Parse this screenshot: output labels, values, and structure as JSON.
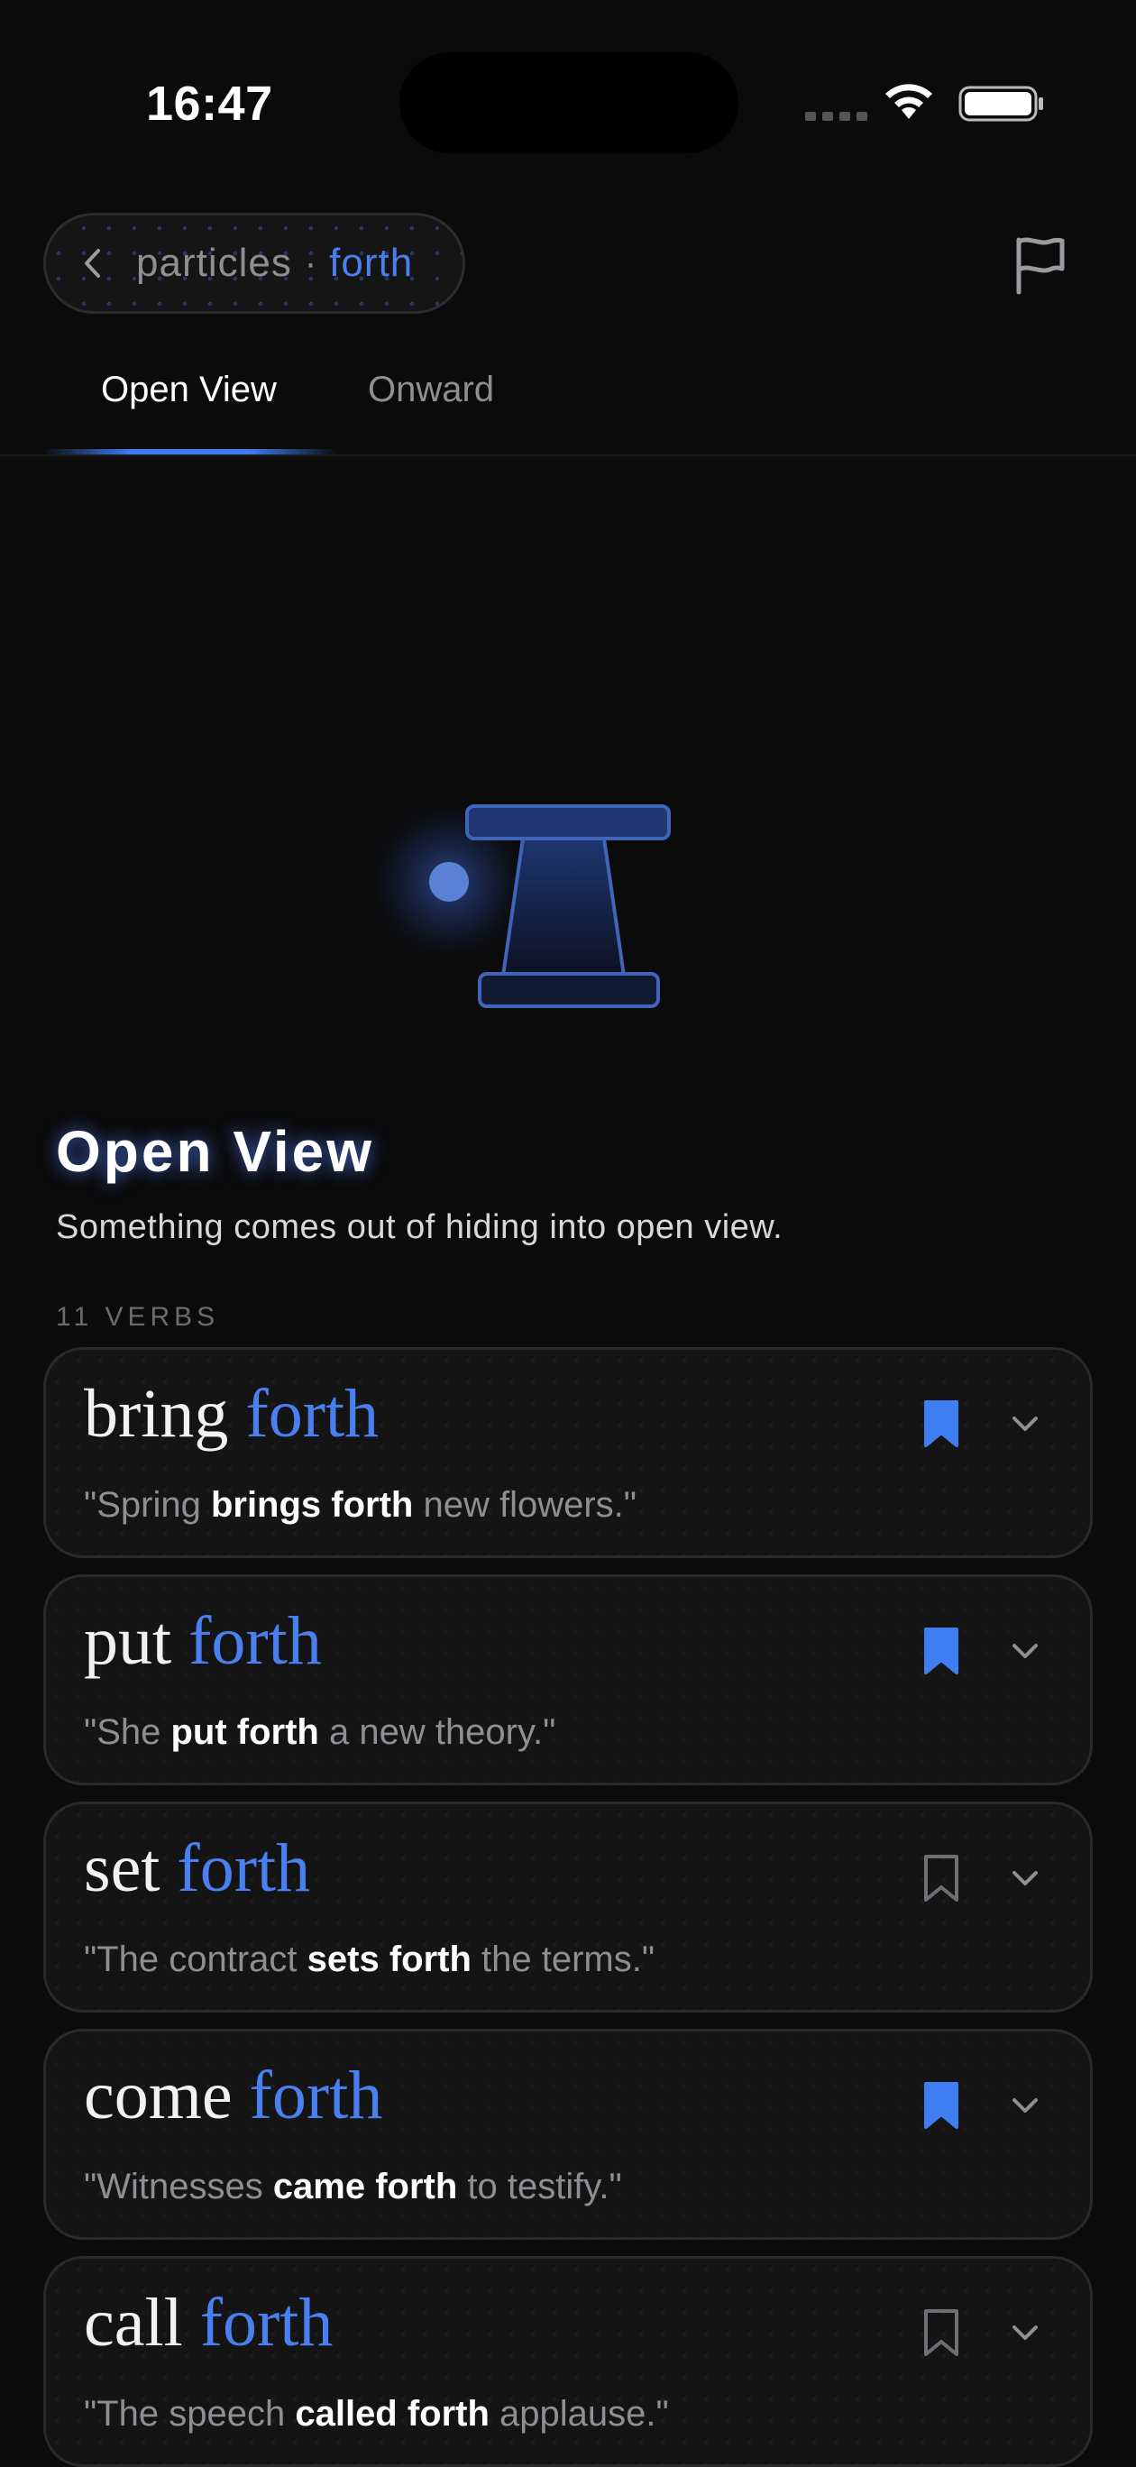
{
  "status_bar": {
    "time": "16:47"
  },
  "header": {
    "breadcrumb_parent": "particles",
    "breadcrumb_separator": "·",
    "breadcrumb_current": "forth"
  },
  "tabs": [
    {
      "label": "Open View",
      "selected": true
    },
    {
      "label": "Onward",
      "selected": false
    }
  ],
  "section": {
    "title": "Open View",
    "description": "Something comes out of hiding into open view.",
    "verb_count": "11 VERBS"
  },
  "colors": {
    "accent": "#4a7ff0",
    "background": "#0b0b0c",
    "card": "#141415"
  },
  "verbs": [
    {
      "verb": "bring",
      "particle": "forth",
      "bookmarked": true,
      "example_pre": "\"Spring ",
      "example_bold": "brings forth",
      "example_post": " new flowers.\""
    },
    {
      "verb": "put",
      "particle": "forth",
      "bookmarked": true,
      "example_pre": "\"She ",
      "example_bold": "put forth",
      "example_post": " a new theory.\""
    },
    {
      "verb": "set",
      "particle": "forth",
      "bookmarked": false,
      "example_pre": "\"The contract ",
      "example_bold": "sets forth",
      "example_post": " the terms.\""
    },
    {
      "verb": "come",
      "particle": "forth",
      "bookmarked": true,
      "example_pre": "\"Witnesses ",
      "example_bold": "came forth",
      "example_post": " to testify.\""
    },
    {
      "verb": "call",
      "particle": "forth",
      "bookmarked": false,
      "example_pre": "\"The speech ",
      "example_bold": "called forth",
      "example_post": " applause.\""
    }
  ]
}
